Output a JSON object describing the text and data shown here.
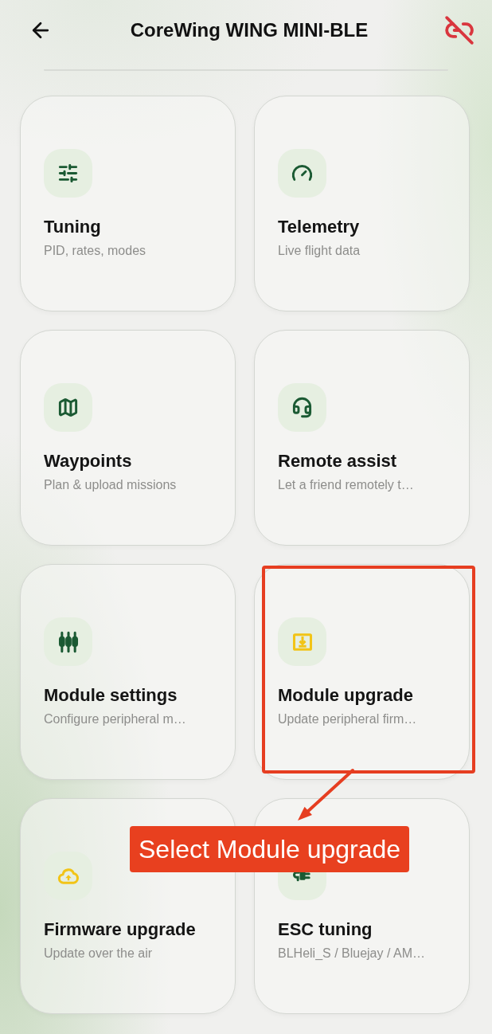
{
  "header": {
    "title": "CoreWing WING MINI-BLE",
    "connected": false
  },
  "cards": [
    {
      "title": "Tuning",
      "subtitle": "PID, rates, modes",
      "color": "#1b5a33",
      "highlighted": false
    },
    {
      "title": "Telemetry",
      "subtitle": "Live flight data",
      "color": "#1b5a33",
      "highlighted": false
    },
    {
      "title": "Waypoints",
      "subtitle": "Plan & upload missions",
      "color": "#1b5a33",
      "highlighted": false
    },
    {
      "title": "Remote assist",
      "subtitle": "Let a friend remotely t…",
      "color": "#1b5a33",
      "highlighted": false
    },
    {
      "title": "Module settings",
      "subtitle": "Configure peripheral m…",
      "color": "#1b5a33",
      "highlighted": false
    },
    {
      "title": "Module upgrade",
      "subtitle": "Update peripheral firm…",
      "color": "#f2c417",
      "highlighted": true
    },
    {
      "title": "Firmware upgrade",
      "subtitle": "Update over the air",
      "color": "#f2c417",
      "highlighted": false
    },
    {
      "title": "ESC tuning",
      "subtitle": "BLHeli_S / Bluejay / AM…",
      "color": "#1b5a33",
      "highlighted": false
    }
  ],
  "annotation": {
    "label": "Select Module upgrade"
  }
}
